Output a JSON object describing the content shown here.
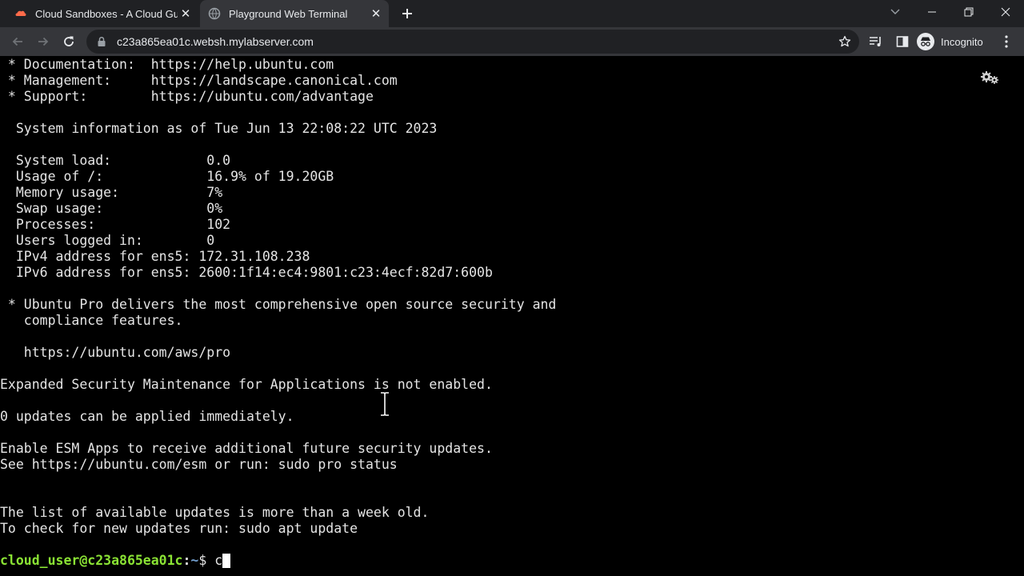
{
  "browser": {
    "tabs": [
      {
        "title": "Cloud Sandboxes - A Cloud Guru",
        "active": false,
        "favicon": "cloud-guru-icon"
      },
      {
        "title": "Playground Web Terminal",
        "active": true,
        "favicon": "terminal-globe-icon"
      }
    ],
    "url": "c23a865ea01c.websh.mylabserver.com",
    "profile_label": "Incognito",
    "colors": {
      "tab_strip": "#202124",
      "toolbar": "#35363a",
      "omnibox": "#202124",
      "text": "#e8eaed",
      "cloud_guru_brand": "#ff6b4a"
    }
  },
  "terminal": {
    "lines": [
      " * Documentation:  https://help.ubuntu.com",
      " * Management:     https://landscape.canonical.com",
      " * Support:        https://ubuntu.com/advantage",
      "",
      "  System information as of Tue Jun 13 22:08:22 UTC 2023",
      "",
      "  System load:            0.0",
      "  Usage of /:             16.9% of 19.20GB",
      "  Memory usage:           7%",
      "  Swap usage:             0%",
      "  Processes:              102",
      "  Users logged in:        0",
      "  IPv4 address for ens5: 172.31.108.238",
      "  IPv6 address for ens5: 2600:1f14:ec4:9801:c23:4ecf:82d7:600b",
      "",
      " * Ubuntu Pro delivers the most comprehensive open source security and",
      "   compliance features.",
      "",
      "   https://ubuntu.com/aws/pro",
      "",
      "Expanded Security Maintenance for Applications is not enabled.",
      "",
      "0 updates can be applied immediately.",
      "",
      "Enable ESM Apps to receive additional future security updates.",
      "See https://ubuntu.com/esm or run: sudo pro status",
      "",
      "",
      "The list of available updates is more than a week old.",
      "To check for new updates run: sudo apt update",
      ""
    ],
    "prompt": {
      "user_host": "cloud_user@c23a865ea01c",
      "separator": ":",
      "path": "~",
      "symbol": "$ ",
      "typed": "c"
    },
    "colors": {
      "background": "#000000",
      "text": "#e5e5e5",
      "prompt_user": "#8ae234",
      "prompt_path": "#729fcf"
    }
  }
}
